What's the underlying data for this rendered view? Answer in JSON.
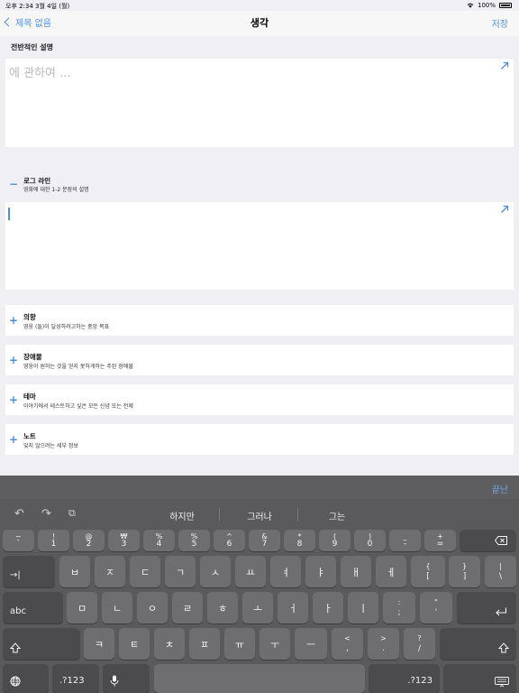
{
  "status_bar": {
    "time": "오후 2:34   3월 4일 (월)",
    "battery": "100%"
  },
  "nav": {
    "back_label": "제목 없음",
    "title": "생각",
    "save_label": "저장"
  },
  "overview": {
    "label": "전반적인 설명",
    "placeholder": "에 관하여 ..."
  },
  "logline": {
    "sign": "−",
    "title": "로그 라인",
    "subtitle": "영화에 대한 1-2 문장의 설명"
  },
  "fields": [
    {
      "sign": "+",
      "title": "의향",
      "subtitle": "영웅 (들)이 달성하려고하는 중앙 목표"
    },
    {
      "sign": "+",
      "title": "장애물",
      "subtitle": "영웅이 원하는 것을 얻지 못하게하는 주된 장애물"
    },
    {
      "sign": "+",
      "title": "테마",
      "subtitle": "이야기에서 테스트하고 싶은 모든 신념 또는 전제"
    },
    {
      "sign": "+",
      "title": "노트",
      "subtitle": "잊지 않으려는 세부 정보"
    }
  ],
  "keyboard": {
    "done_label": "끝난",
    "icons": {
      "undo": "undo-icon",
      "redo": "redo-icon",
      "paste": "paste-icon"
    },
    "suggestions": [
      "하지만",
      "그러나",
      "그는"
    ],
    "number_row": [
      {
        "top": "~",
        "bot": "`"
      },
      {
        "top": "!",
        "bot": "1"
      },
      {
        "top": "@",
        "bot": "2"
      },
      {
        "top": "₩",
        "bot": "3"
      },
      {
        "top": "%",
        "bot": "4"
      },
      {
        "top": "%",
        "bot": "5"
      },
      {
        "top": "^",
        "bot": "6"
      },
      {
        "top": "&",
        "bot": "7"
      },
      {
        "top": "*",
        "bot": "8"
      },
      {
        "top": "(",
        "bot": "9"
      },
      {
        "top": ")",
        "bot": "0"
      },
      {
        "top": "_",
        "bot": "-"
      },
      {
        "top": "+",
        "bot": "="
      }
    ],
    "row1": [
      "ㅂ",
      "ㅈ",
      "ㄷ",
      "ㄱ",
      "ㅅ",
      "ㅛ",
      "ㅕ",
      "ㅑ",
      "ㅐ",
      "ㅔ"
    ],
    "row1_extra": [
      {
        "top": "{",
        "bot": "["
      },
      {
        "top": "}",
        "bot": "]"
      },
      {
        "top": "|",
        "bot": "\\"
      }
    ],
    "row2": [
      "ㅁ",
      "ㄴ",
      "ㅇ",
      "ㄹ",
      "ㅎ",
      "ㅗ",
      "ㅓ",
      "ㅏ",
      "ㅣ"
    ],
    "row2_extra": [
      {
        "top": ":",
        "bot": ";"
      },
      {
        "top": "\"",
        "bot": "'"
      }
    ],
    "row3": [
      "ㅋ",
      "ㅌ",
      "ㅊ",
      "ㅍ",
      "ㅠ",
      "ㅜ",
      "ㅡ"
    ],
    "row3_extra": [
      {
        "top": "<",
        "bot": ","
      },
      {
        "top": ">",
        "bot": "."
      },
      {
        "top": "?",
        "bot": "/"
      }
    ],
    "tab_label": "→|",
    "abc_label": "abc",
    "numbers_label": ".?123",
    "accent_color": "#4a90e2"
  }
}
